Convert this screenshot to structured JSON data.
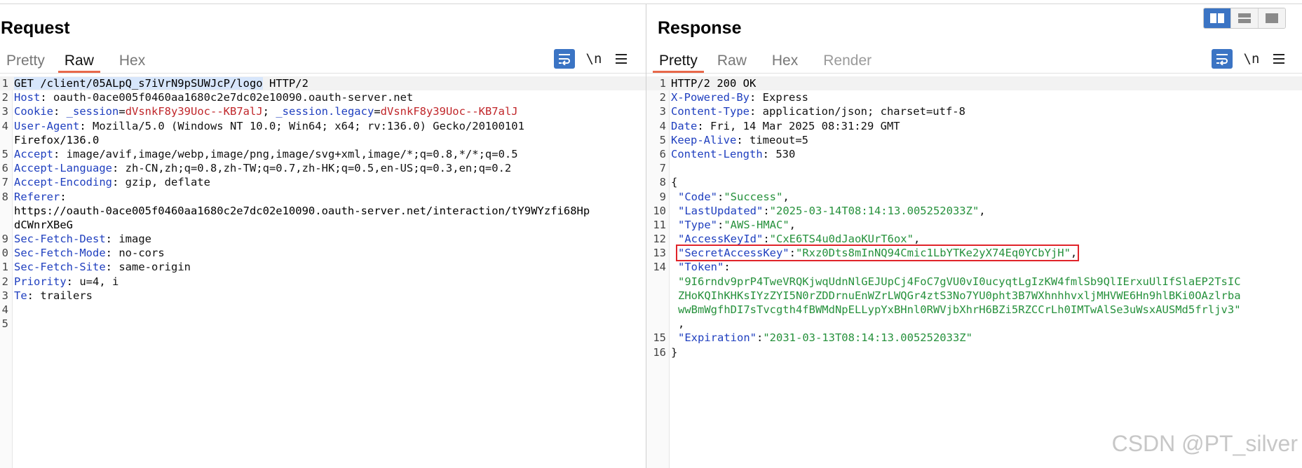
{
  "request": {
    "title": "Request",
    "tabs": [
      {
        "label": "Pretty",
        "active": false
      },
      {
        "label": "Raw",
        "active": true
      },
      {
        "label": "Hex",
        "active": false
      }
    ],
    "tools": {
      "wrap_icon": "wrap-lines-icon",
      "newline_label": "\\n",
      "menu_icon": "hamburger-menu-icon"
    },
    "lines": [
      {
        "n": "1",
        "request_line": "GET /client/05ALpQ_s7iVrN9pSUWJcP/logo",
        "protocol": " HTTP/2"
      },
      {
        "n": "2",
        "key": "Host",
        "value": " oauth-0ace005f0460aa1680c2e7dc02e10090.oauth-server.net"
      },
      {
        "n": "3",
        "key": "Cookie",
        "c1_name": " _session",
        "c1_value": "dVsnkF8y39Uoc--KB7alJ",
        "sep": "; ",
        "c2_name": "_session.legacy",
        "c2_value": "dVsnkF8y39Uoc--KB7alJ"
      },
      {
        "n": "4",
        "key": "User-Agent",
        "value": " Mozilla/5.0 (Windows NT 10.0; Win64; x64; rv:136.0) Gecko/20100101"
      },
      {
        "n": "",
        "cont": "Firefox/136.0"
      },
      {
        "n": "5",
        "key": "Accept",
        "value": " image/avif,image/webp,image/png,image/svg+xml,image/*;q=0.8,*/*;q=0.5"
      },
      {
        "n": "6",
        "key": "Accept-Language",
        "value": " zh-CN,zh;q=0.8,zh-TW;q=0.7,zh-HK;q=0.5,en-US;q=0.3,en;q=0.2"
      },
      {
        "n": "7",
        "key": "Accept-Encoding",
        "value": " gzip, deflate"
      },
      {
        "n": "8",
        "key": "Referer",
        "value": ""
      },
      {
        "n": "",
        "cont": "https://oauth-0ace005f0460aa1680c2e7dc02e10090.oauth-server.net/interaction/tY9WYzfi68Hp"
      },
      {
        "n": "",
        "cont": "dCWnrXBeG"
      },
      {
        "n": "9",
        "key": "Sec-Fetch-Dest",
        "value": " image"
      },
      {
        "n": "0",
        "key": "Sec-Fetch-Mode",
        "value": " no-cors"
      },
      {
        "n": "1",
        "key": "Sec-Fetch-Site",
        "value": " same-origin"
      },
      {
        "n": "2",
        "key": "Priority",
        "value": " u=4, i"
      },
      {
        "n": "3",
        "key": "Te",
        "value": " trailers"
      },
      {
        "n": "4",
        "cont": ""
      },
      {
        "n": "5",
        "cont": ""
      }
    ]
  },
  "response": {
    "title": "Response",
    "tabs": [
      {
        "label": "Pretty",
        "active": true
      },
      {
        "label": "Raw",
        "active": false
      },
      {
        "label": "Hex",
        "active": false
      },
      {
        "label": "Render",
        "active": false
      }
    ],
    "tools": {
      "wrap_icon": "wrap-lines-icon",
      "newline_label": "\\n",
      "menu_icon": "hamburger-menu-icon"
    },
    "status_line": "HTTP/2 200 OK",
    "headers": [
      {
        "n": "2",
        "key": "X-Powered-By",
        "value": " Express"
      },
      {
        "n": "3",
        "key": "Content-Type",
        "value": " application/json; charset=utf-8"
      },
      {
        "n": "4",
        "key": "Date",
        "value": " Fri, 14 Mar 2025 08:31:29 GMT"
      },
      {
        "n": "5",
        "key": "Keep-Alive",
        "value": " timeout=5"
      },
      {
        "n": "6",
        "key": "Content-Length",
        "value": " 530"
      }
    ],
    "json": {
      "open_brace": "{",
      "close_brace": "}",
      "entries": [
        {
          "n": "9",
          "key": "\"Code\"",
          "value": "\"Success\"",
          "comma": ","
        },
        {
          "n": "10",
          "key": "\"LastUpdated\"",
          "value": "\"2025-03-14T08:14:13.005252033Z\"",
          "comma": ","
        },
        {
          "n": "11",
          "key": "\"Type\"",
          "value": "\"AWS-HMAC\"",
          "comma": ","
        },
        {
          "n": "12",
          "key": "\"AccessKeyId\"",
          "value": "\"CxE6TS4u0dJaoKUrT6ox\"",
          "comma": ","
        },
        {
          "n": "13",
          "key": "\"SecretAccessKey\"",
          "value": "\"Rxz0Dts8mInNQ94Cmic1LbYTKe2yX74Eq0YCbYjH\"",
          "comma": ",",
          "highlighted": true
        }
      ],
      "token_key": "\"Token\"",
      "token_lines": [
        "\"9I6rndv9prP4TweVRQKjwqUdnNlGEJUpCj4FoC7gVU0vI0ucyqtLgIzKW4fmlSb9QlIErxuUlIfSlaEP2TsIC",
        "ZHoKQIhKHKsIYzZYI5N0rZDDrnuEnWZrLWQGr4ztS3No7YU0pht3B7WXhnhhvxljMHVWE6Hn9hlBKi0OAzlrba",
        "wwBmWgfhDI7sTvcgth4fBWMdNpELLypYxBHnl0RWVjbXhrH6BZi5RZCCrLh0IMTwAlSe3uWsxAUSMd5frljv3\""
      ],
      "token_comma": ",",
      "expiration_key": "\"Expiration\"",
      "expiration_value": "\"2031-03-13T08:14:13.005252033Z\""
    },
    "line_numbers": {
      "status": "1",
      "blank": "7",
      "open": "8",
      "token": "14",
      "expiration": "15",
      "close": "16"
    }
  },
  "layout_toggles": [
    {
      "icon": "split-vertical-icon",
      "active": true
    },
    {
      "icon": "split-horizontal-icon",
      "active": false
    },
    {
      "icon": "single-pane-icon",
      "active": false
    }
  ],
  "watermark": "CSDN @PT_silver",
  "colors": {
    "header_key": "#1f3fbf",
    "cookie_value": "#c0262a",
    "json_string": "#26913c",
    "accent_tab": "#e8684a",
    "button_blue": "#3b74c4",
    "highlight_box": "#e0242a"
  }
}
